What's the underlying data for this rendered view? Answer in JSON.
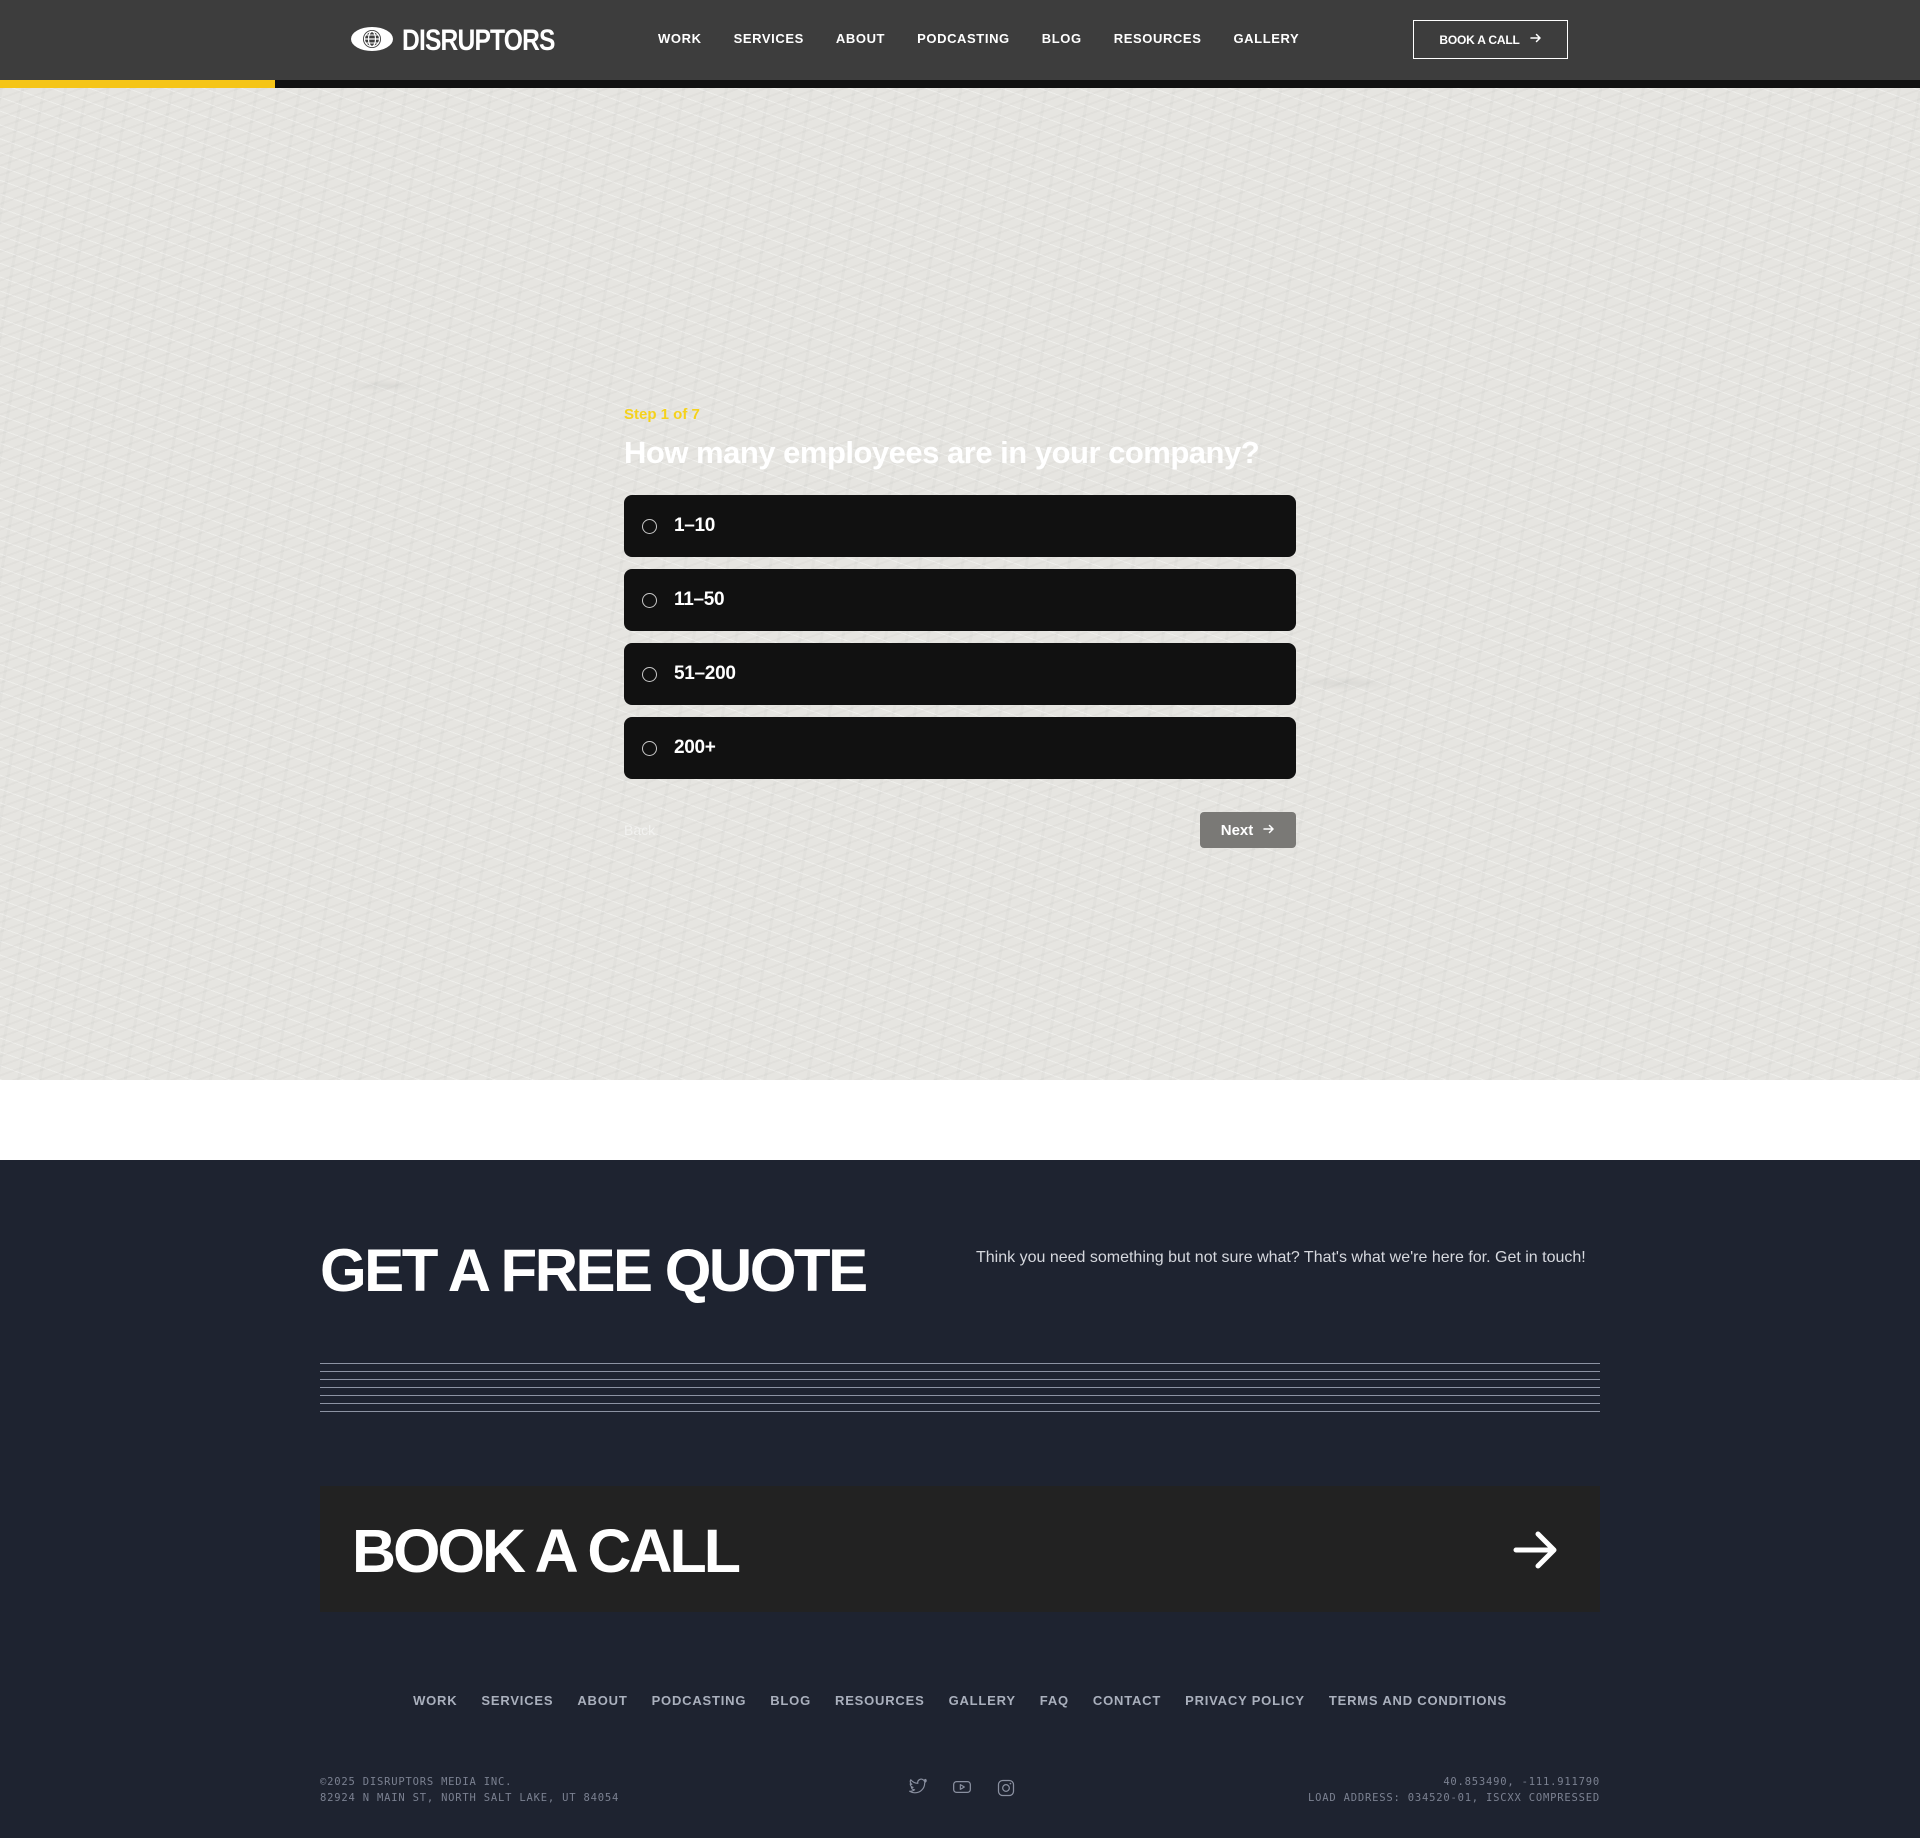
{
  "header": {
    "logo_text": "DISRUPTORS",
    "nav": [
      "WORK",
      "SERVICES",
      "ABOUT",
      "PODCASTING",
      "BLOG",
      "RESOURCES",
      "GALLERY"
    ],
    "book_label": "BOOK A CALL",
    "progress_fraction": 0.143
  },
  "quiz": {
    "step": "Step 1 of 7",
    "question": "How many employees are in your company?",
    "options": [
      "1–10",
      "11–50",
      "51–200",
      "200+"
    ],
    "back_label": "Back",
    "next_label": "Next"
  },
  "footer": {
    "quote_title": "GET A FREE QUOTE",
    "quote_text": "Think you need something but not sure what? That's what we're here for. Get in touch!",
    "book_label": "BOOK A CALL",
    "nav": [
      "WORK",
      "SERVICES",
      "ABOUT",
      "PODCASTING",
      "BLOG",
      "RESOURCES",
      "GALLERY",
      "FAQ",
      "CONTACT",
      "PRIVACY POLICY",
      "TERMS AND CONDITIONS"
    ],
    "copyright": "©2025 DISRUPTORS MEDIA INC.",
    "address": "82924 N MAIN ST, NORTH SALT LAKE, UT 84054",
    "coords": "40.853490, -111.911790",
    "load_address": "LOAD ADDRESS: 034520-01, ISCXX COMPRESSED",
    "socials": [
      "twitter-icon",
      "youtube-icon",
      "instagram-icon"
    ]
  },
  "colors": {
    "accent": "#f5c518",
    "header_bg": "#3d3d3d",
    "footer_bg": "#1e2330"
  }
}
